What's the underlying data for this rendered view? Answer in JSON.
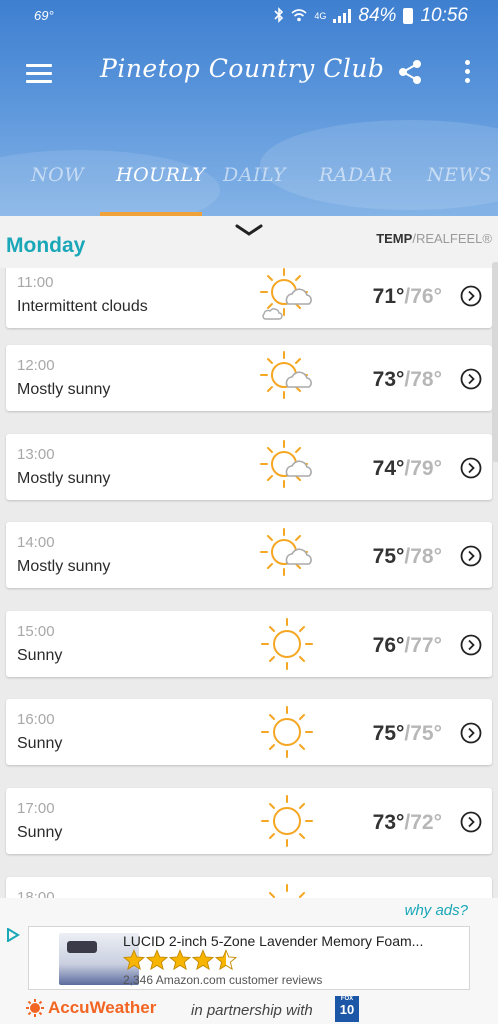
{
  "status_bar": {
    "temperature": "69°",
    "network": "4G",
    "battery": "84%",
    "time": "10:56"
  },
  "app_bar": {
    "title": "Pinetop Country Club"
  },
  "tabs": [
    {
      "label": "NOW",
      "active": false
    },
    {
      "label": "HOURLY",
      "active": true
    },
    {
      "label": "DAILY",
      "active": false
    },
    {
      "label": "RADAR",
      "active": false
    },
    {
      "label": "NEWS",
      "active": false
    }
  ],
  "subheader": {
    "day": "Monday",
    "temp_label": "TEMP",
    "separator": "/",
    "realfeel_label": "REALFEEL®"
  },
  "hours": [
    {
      "time": "11:00",
      "condition": "Intermittent clouds",
      "temp": "71°",
      "realfeel": "/76°",
      "icon": "sun-cloud-icon"
    },
    {
      "time": "12:00",
      "condition": "Mostly sunny",
      "temp": "73°",
      "realfeel": "/78°",
      "icon": "sun-cloud-icon"
    },
    {
      "time": "13:00",
      "condition": "Mostly sunny",
      "temp": "74°",
      "realfeel": "/79°",
      "icon": "sun-cloud-icon"
    },
    {
      "time": "14:00",
      "condition": "Mostly sunny",
      "temp": "75°",
      "realfeel": "/78°",
      "icon": "sun-cloud-icon"
    },
    {
      "time": "15:00",
      "condition": "Sunny",
      "temp": "76°",
      "realfeel": "/77°",
      "icon": "sun-icon"
    },
    {
      "time": "16:00",
      "condition": "Sunny",
      "temp": "75°",
      "realfeel": "/75°",
      "icon": "sun-icon"
    },
    {
      "time": "17:00",
      "condition": "Sunny",
      "temp": "73°",
      "realfeel": "/72°",
      "icon": "sun-icon"
    },
    {
      "time": "18:00",
      "condition": "",
      "temp": "",
      "realfeel": "",
      "icon": "sun-icon"
    }
  ],
  "ad": {
    "why_ads": "why ads?",
    "title": "LUCID 2-inch 5-Zone Lavender Memory Foam...",
    "rating": 4.5,
    "reviews": "2,346 Amazon.com customer reviews"
  },
  "footer": {
    "brand": "AccuWeather",
    "partner_text": "in partnership with",
    "partner_logo": "10",
    "partner_logo_top": "FOX"
  },
  "colors": {
    "header_blue": "#3e7fd0",
    "accent_teal": "#1aa7b8",
    "tab_underline": "#f0a23a",
    "sun_orange": "#f5a623",
    "brand_orange": "#f26522"
  }
}
